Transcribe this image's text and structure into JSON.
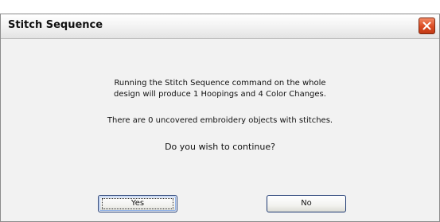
{
  "dialog": {
    "title": "Stitch Sequence",
    "message_line1": "Running the Stitch Sequence command on the whole",
    "message_line2": "design will produce 1 Hoopings and 4 Color Changes.",
    "uncovered_text": "There are 0 uncovered embroidery objects with stitches.",
    "question": "Do you wish to continue?",
    "yes_label": "Yes",
    "no_label": "No"
  },
  "colors": {
    "close_button": "#db4b23",
    "dialog_background": "#f2f2f2",
    "button_border": "#1f3a73"
  },
  "icons": {
    "close": "close-icon"
  }
}
